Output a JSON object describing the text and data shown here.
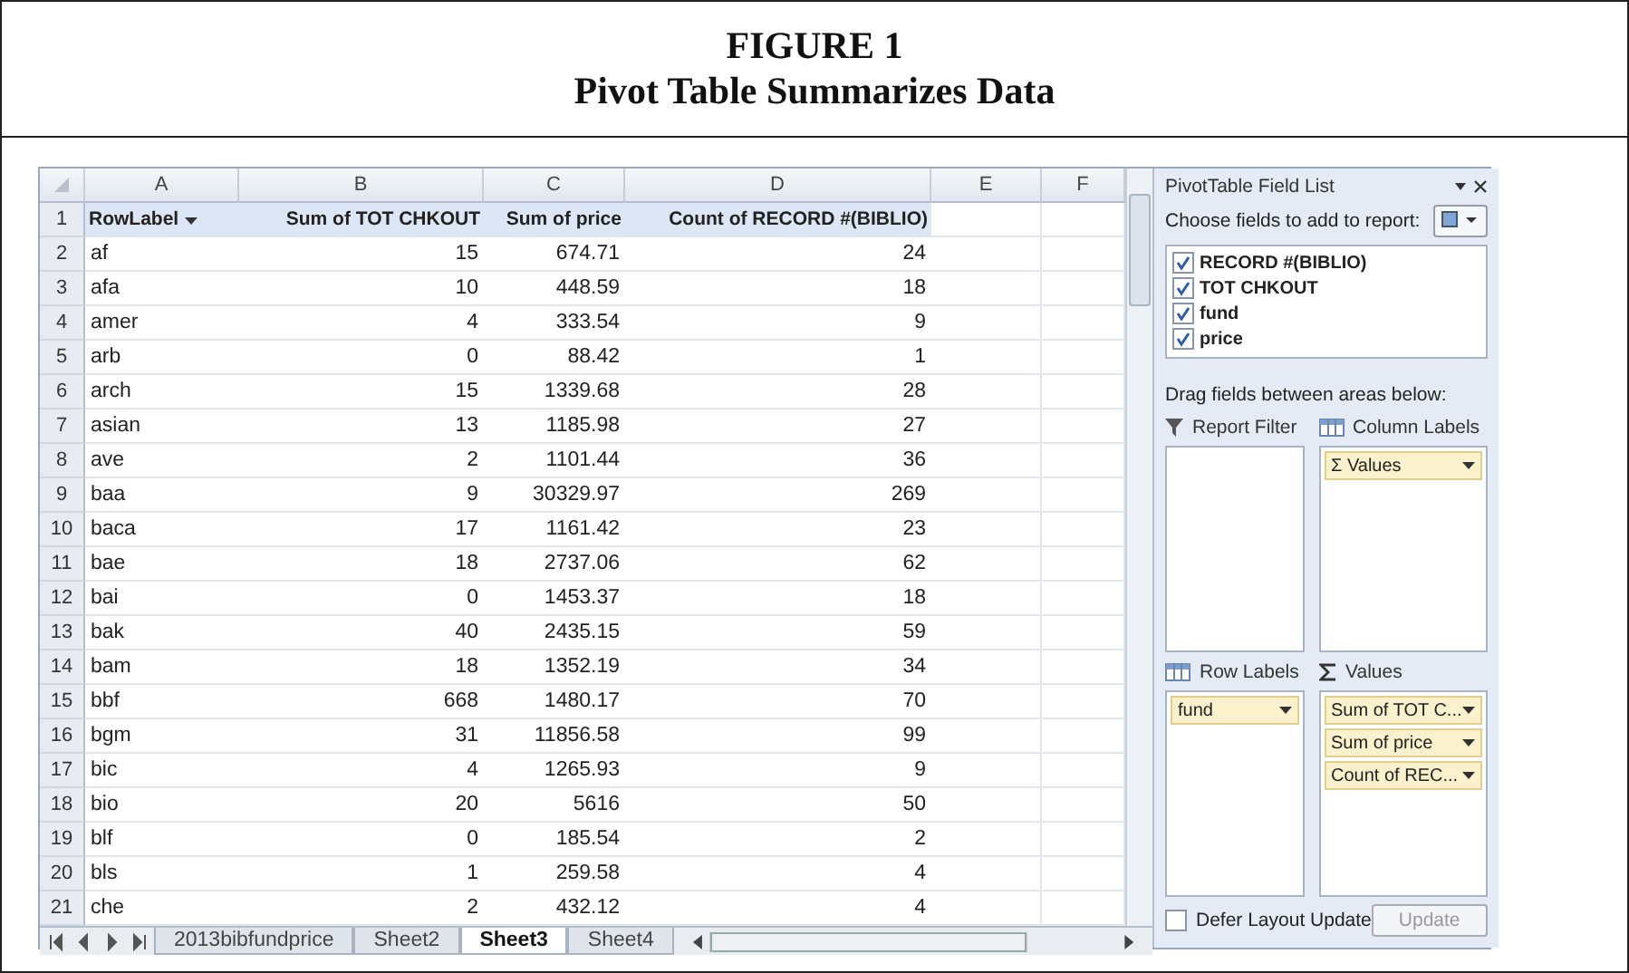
{
  "figure": {
    "label": "FIGURE 1",
    "title": "Pivot Table Summarizes Data"
  },
  "sheet": {
    "columns": [
      "A",
      "B",
      "C",
      "D",
      "E",
      "F"
    ],
    "header": {
      "number": "1",
      "cells": [
        "RowLabel",
        "Sum of TOT CHKOUT",
        "Sum of price",
        "Count of RECORD #(BIBLIO)"
      ]
    },
    "rows": [
      {
        "number": "2",
        "cells": [
          "af",
          "15",
          "674.71",
          "24"
        ]
      },
      {
        "number": "3",
        "cells": [
          "afa",
          "10",
          "448.59",
          "18"
        ]
      },
      {
        "number": "4",
        "cells": [
          "amer",
          "4",
          "333.54",
          "9"
        ]
      },
      {
        "number": "5",
        "cells": [
          "arb",
          "0",
          "88.42",
          "1"
        ]
      },
      {
        "number": "6",
        "cells": [
          "arch",
          "15",
          "1339.68",
          "28"
        ]
      },
      {
        "number": "7",
        "cells": [
          "asian",
          "13",
          "1185.98",
          "27"
        ]
      },
      {
        "number": "8",
        "cells": [
          "ave",
          "2",
          "1101.44",
          "36"
        ]
      },
      {
        "number": "9",
        "cells": [
          "baa",
          "9",
          "30329.97",
          "269"
        ]
      },
      {
        "number": "10",
        "cells": [
          "baca",
          "17",
          "1161.42",
          "23"
        ]
      },
      {
        "number": "11",
        "cells": [
          "bae",
          "18",
          "2737.06",
          "62"
        ]
      },
      {
        "number": "12",
        "cells": [
          "bai",
          "0",
          "1453.37",
          "18"
        ]
      },
      {
        "number": "13",
        "cells": [
          "bak",
          "40",
          "2435.15",
          "59"
        ]
      },
      {
        "number": "14",
        "cells": [
          "bam",
          "18",
          "1352.19",
          "34"
        ]
      },
      {
        "number": "15",
        "cells": [
          "bbf",
          "668",
          "1480.17",
          "70"
        ]
      },
      {
        "number": "16",
        "cells": [
          "bgm",
          "31",
          "11856.58",
          "99"
        ]
      },
      {
        "number": "17",
        "cells": [
          "bic",
          "4",
          "1265.93",
          "9"
        ]
      },
      {
        "number": "18",
        "cells": [
          "bio",
          "20",
          "5616",
          "50"
        ]
      },
      {
        "number": "19",
        "cells": [
          "blf",
          "0",
          "185.54",
          "2"
        ]
      },
      {
        "number": "20",
        "cells": [
          "bls",
          "1",
          "259.58",
          "4"
        ]
      },
      {
        "number": "21",
        "cells": [
          "che",
          "2",
          "432.12",
          "4"
        ]
      }
    ],
    "tabs": [
      {
        "label": "2013bibfundprice",
        "selected": false
      },
      {
        "label": "Sheet2",
        "selected": false
      },
      {
        "label": "Sheet3",
        "selected": true
      },
      {
        "label": "Sheet4",
        "selected": false
      }
    ]
  },
  "field_list": {
    "title": "PivotTable Field List",
    "prompt": "Choose fields to add to report:",
    "fields": [
      {
        "label": "RECORD #(BIBLIO)",
        "checked": true
      },
      {
        "label": "TOT CHKOUT",
        "checked": true
      },
      {
        "label": "fund",
        "checked": true
      },
      {
        "label": "price",
        "checked": true
      }
    ],
    "areas_prompt": "Drag fields between areas below:",
    "areas": [
      {
        "kind": "filter",
        "label": "Report Filter"
      },
      {
        "kind": "columns",
        "label": "Column Labels",
        "items": [
          "Σ Values"
        ]
      },
      {
        "kind": "rows",
        "label": "Row Labels",
        "items": [
          "fund"
        ]
      },
      {
        "kind": "values",
        "label": "Values",
        "items": [
          "Sum of TOT C...",
          "Sum of price",
          "Count of REC..."
        ]
      }
    ],
    "defer": {
      "label": "Defer Layout Update",
      "checked": false
    },
    "update": {
      "label": "Update",
      "disabled": true
    }
  }
}
